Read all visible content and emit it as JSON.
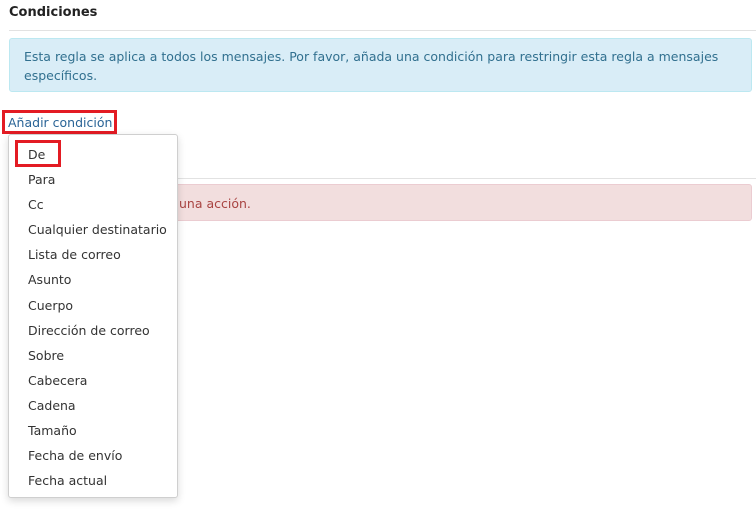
{
  "conditions": {
    "title": "Condiciones",
    "info_message": "Esta regla se aplica a todos los mensajes. Por favor, añada una condición para restringir esta regla a mensajes específicos.",
    "add_condition_label": "Añadir condición"
  },
  "actions": {
    "warning_message_visible": "una acción."
  },
  "dropdown": {
    "items": [
      "De",
      "Para",
      "Cc",
      "Cualquier destinatario",
      "Lista de correo",
      "Asunto",
      "Cuerpo",
      "Dirección de correo",
      "Sobre",
      "Cabecera",
      "Cadena",
      "Tamaño",
      "Fecha de envío",
      "Fecha actual"
    ]
  },
  "colors": {
    "highlight": "#e31b23",
    "link": "#2a6496",
    "info_bg": "#d9edf7",
    "danger_bg": "#f2dede"
  }
}
